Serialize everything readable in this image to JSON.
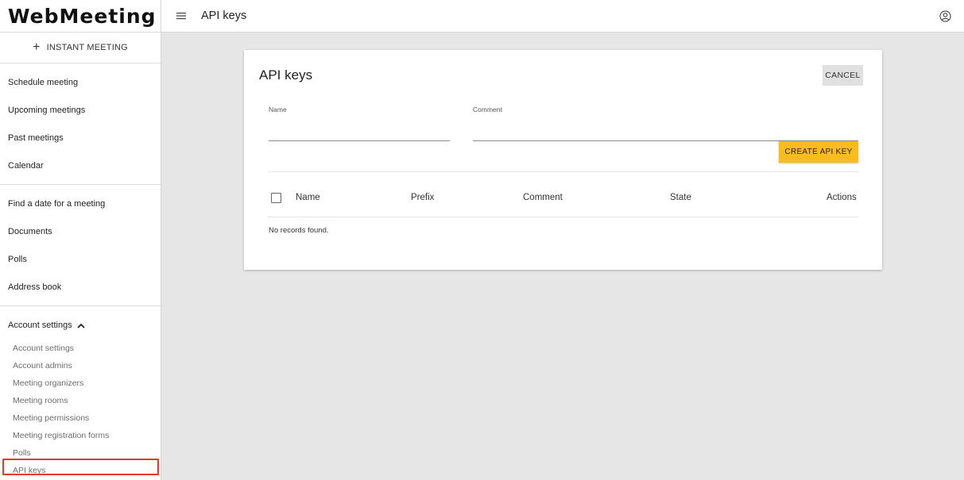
{
  "app": {
    "logo": "WebMeeting"
  },
  "sidebar": {
    "instant_meeting": "INSTANT MEETING",
    "group1": [
      "Schedule meeting",
      "Upcoming meetings",
      "Past meetings",
      "Calendar"
    ],
    "group2": [
      "Find a date for a meeting",
      "Documents",
      "Polls",
      "Address book"
    ],
    "account_settings": {
      "label": "Account settings",
      "items": [
        "Account settings",
        "Account admins",
        "Meeting organizers",
        "Meeting rooms",
        "Meeting permissions",
        "Meeting registration forms",
        "Polls",
        "API keys"
      ]
    }
  },
  "header": {
    "title": "API keys"
  },
  "card": {
    "title": "API keys",
    "cancel_label": "CANCEL",
    "name_label": "Name",
    "name_value": "",
    "comment_label": "Comment",
    "comment_value": "",
    "create_label": "CREATE API KEY",
    "table": {
      "columns": [
        "Name",
        "Prefix",
        "Comment",
        "State",
        "Actions"
      ],
      "empty_message": "No records found."
    }
  },
  "colors": {
    "accent": "#fbbc1c",
    "highlight": "#e53935"
  }
}
